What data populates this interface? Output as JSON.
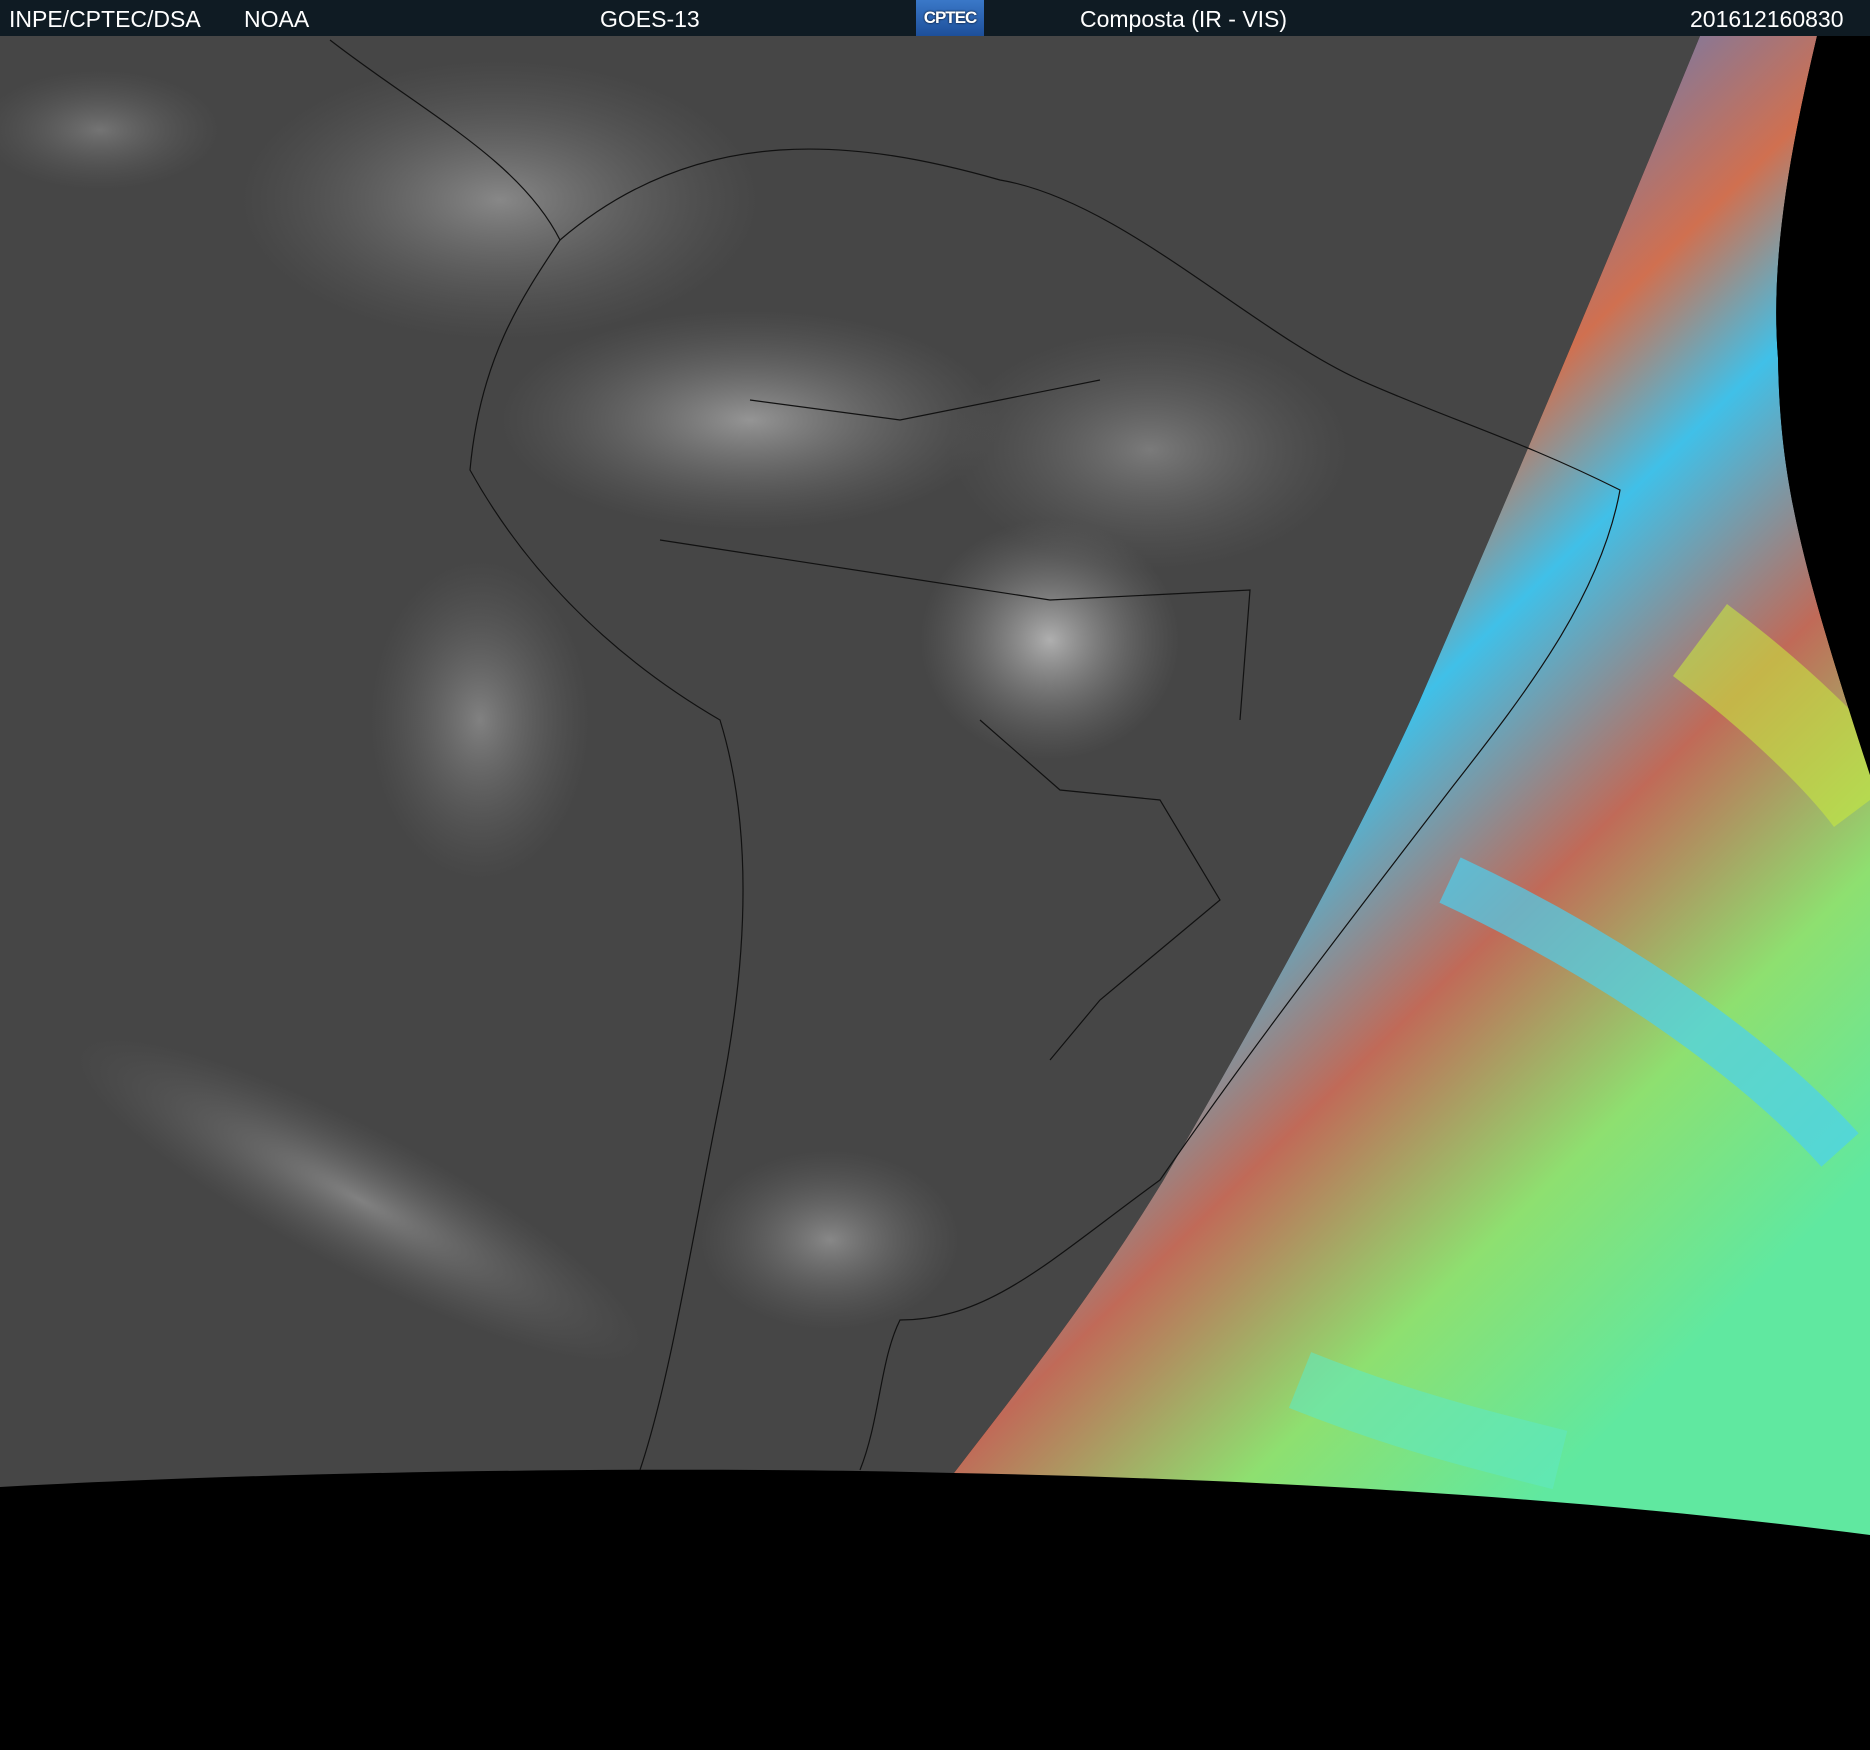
{
  "header": {
    "org": "INPE/CPTEC/DSA",
    "agency": "NOAA",
    "satellite": "GOES-13",
    "logo_text": "CPTEC",
    "product": "Composta (IR - VIS)",
    "timestamp": "201612160830"
  },
  "colors": {
    "header_bg": "#0f1b23",
    "ir_gray": "#4a4a4a",
    "vis_red": "#c0605a",
    "vis_green": "#9ee860",
    "vis_blue": "#3a8ae8"
  }
}
